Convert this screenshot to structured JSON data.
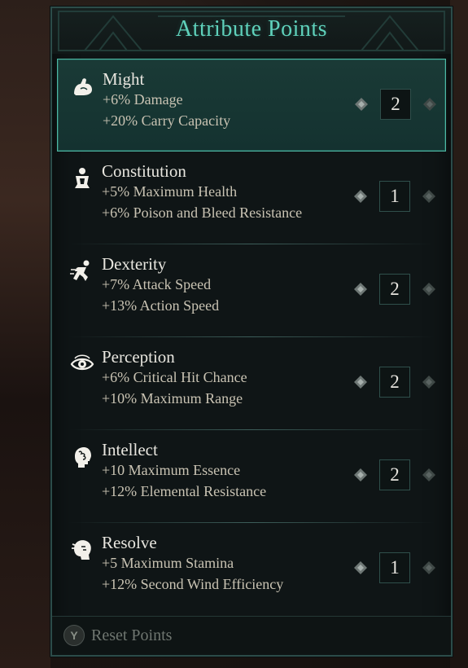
{
  "title": "Attribute Points",
  "colors": {
    "accent": "#5fd1bb",
    "panel_border": "#2c4c49",
    "selected_bg": "#1a3a36"
  },
  "attributes": [
    {
      "name": "Might",
      "icon": "flexed-arm-icon",
      "effects": [
        "+6% Damage",
        "+20% Carry Capacity"
      ],
      "value": "2",
      "selected": true
    },
    {
      "name": "Constitution",
      "icon": "body-icon",
      "effects": [
        "+5% Maximum Health",
        "+6% Poison and Bleed Resistance"
      ],
      "value": "1",
      "selected": false
    },
    {
      "name": "Dexterity",
      "icon": "running-figure-icon",
      "effects": [
        "+7% Attack Speed",
        "+13% Action Speed"
      ],
      "value": "2",
      "selected": false
    },
    {
      "name": "Perception",
      "icon": "eye-icon",
      "effects": [
        "+6% Critical Hit Chance",
        "+10% Maximum Range"
      ],
      "value": "2",
      "selected": false
    },
    {
      "name": "Intellect",
      "icon": "head-brain-icon",
      "effects": [
        "+10 Maximum Essence",
        "+12% Elemental Resistance"
      ],
      "value": "2",
      "selected": false
    },
    {
      "name": "Resolve",
      "icon": "resolve-face-icon",
      "effects": [
        "+5 Maximum Stamina",
        "+12% Second Wind Efficiency"
      ],
      "value": "1",
      "selected": false
    }
  ],
  "footer": {
    "button_glyph": "Y",
    "reset_label": "Reset Points"
  }
}
